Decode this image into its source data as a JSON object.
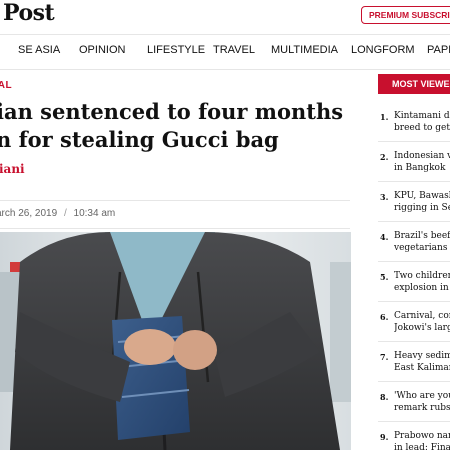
{
  "brand": {
    "logo_text": "Post",
    "premium_label": "PREMIUM SUBSCRIPTION"
  },
  "nav": {
    "items": [
      {
        "label": "SE ASIA"
      },
      {
        "label": "OPINION"
      },
      {
        "label": "LIFESTYLE"
      },
      {
        "label": "TRAVEL"
      },
      {
        "label": "MULTIMEDIA"
      },
      {
        "label": "LONGFORM"
      },
      {
        "label": "PAPER"
      }
    ]
  },
  "article": {
    "category": "NAL",
    "headline_line1": "ian sentenced to four months",
    "headline_line2": "n for stealing Gucci bag",
    "author": "iani",
    "date": "arch 26, 2019",
    "separator": "/",
    "time": "10:34 am",
    "photo_icon": "man-hiding-jeans-photo"
  },
  "most_viewed": {
    "header": "MOST VIEWED",
    "items": [
      {
        "num": "1.",
        "line1": "Kintamani do",
        "line2": "breed to get in"
      },
      {
        "num": "2.",
        "line1": "Indonesian v",
        "line2": "in Bangkok"
      },
      {
        "num": "3.",
        "line1": "KPU, Bawaslu",
        "line2": "rigging in Sel"
      },
      {
        "num": "4.",
        "line1": "Brazil's beef e",
        "line2": "vegetarians"
      },
      {
        "num": "5.",
        "line1": "Two children",
        "line2": "explosion in N"
      },
      {
        "num": "6.",
        "line1": "Carnival, con",
        "line2": "Jokowi's larg"
      },
      {
        "num": "7.",
        "line1": "Heavy sedime",
        "line2": "East Kaliman"
      },
      {
        "num": "8.",
        "line1": "'Who are you",
        "line2": "remark rubs I"
      },
      {
        "num": "9.",
        "line1": "Prabowo nar",
        "line2": "in lead: Final"
      }
    ]
  },
  "colors": {
    "accent": "#c8102e",
    "text": "#111111",
    "muted": "#666666"
  }
}
